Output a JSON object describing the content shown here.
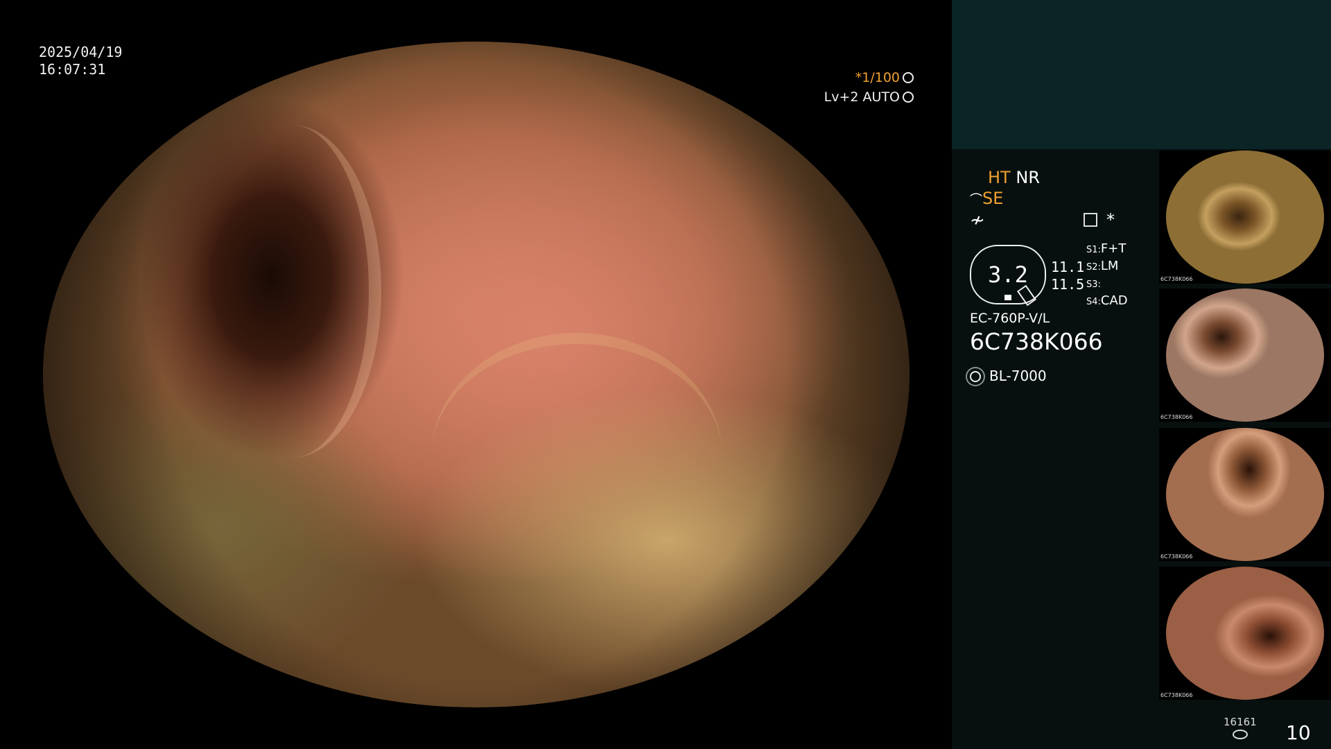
{
  "datetime": {
    "date": "2025/04/19",
    "time": "16:07:31"
  },
  "scope_overlay": {
    "shutter": "*1/100",
    "level": "Lv+2 AUTO"
  },
  "panel": {
    "ht": "HT",
    "nr": "NR",
    "se": "SE",
    "tilde": "≁",
    "asterisk": "*",
    "zoom": "3.2",
    "scale_1": "11.1",
    "scale_2": "11.5",
    "switches": [
      {
        "key": "S1:",
        "value": "F+T"
      },
      {
        "key": "S2:",
        "value": "LM"
      },
      {
        "key": "S3:",
        "value": ""
      },
      {
        "key": "S4:",
        "value": "CAD"
      }
    ],
    "scope_model": "EC-760P-V/L",
    "scope_serial": "6C738K066",
    "light_source": "BL-7000",
    "counter_small": "16161",
    "counter_big": "10"
  },
  "thumbnails": [
    {
      "label": "6C738K066"
    },
    {
      "label": "6C738K066"
    },
    {
      "label": "6C738K066"
    },
    {
      "label": "6C738K066"
    }
  ],
  "colors": {
    "accent_orange": "#f0a030",
    "panel_top": "#0b2526",
    "panel_bg": "#07100f"
  }
}
